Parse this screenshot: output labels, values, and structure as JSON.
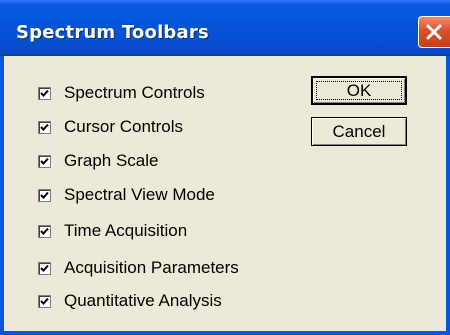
{
  "window": {
    "title": "Spectrum Toolbars",
    "close_icon": "close-x-icon",
    "accent_color": "#0454D9",
    "close_color": "#D9512C"
  },
  "options": [
    {
      "label": "Spectrum Controls",
      "checked": true
    },
    {
      "label": "Cursor Controls",
      "checked": true
    },
    {
      "label": "Graph Scale",
      "checked": true
    },
    {
      "label": "Spectral View Mode",
      "checked": true
    },
    {
      "label": "Time Acquisition",
      "checked": true
    },
    {
      "label": "Acquisition Parameters",
      "checked": true
    },
    {
      "label": "Quantitative Analysis",
      "checked": true
    }
  ],
  "buttons": {
    "ok_label": "OK",
    "cancel_label": "Cancel"
  }
}
